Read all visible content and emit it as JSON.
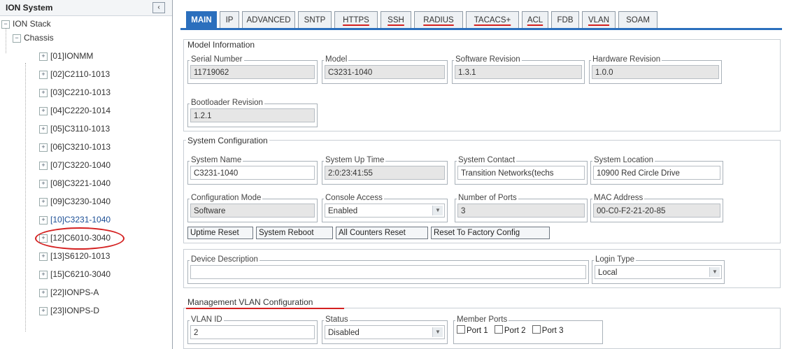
{
  "tree": {
    "title": "ION System",
    "collapse_icon": "‹",
    "stack_label": "ION Stack",
    "chassis_label": "Chassis",
    "items": [
      "[01]IONMM",
      "[02]C2110-1013",
      "[03]C2210-1013",
      "[04]C2220-1014",
      "[05]C3110-1013",
      "[06]C3210-1013",
      "[07]C3220-1040",
      "[08]C3221-1040",
      "[09]C3230-1040",
      "[10]C3231-1040",
      "[12]C6010-3040",
      "[13]S6120-1013",
      "[15]C6210-3040",
      "[22]IONPS-A",
      "[23]IONPS-D"
    ],
    "selected_item": "[10]C3231-1040"
  },
  "tabs": [
    {
      "label": "MAIN",
      "active": true
    },
    {
      "label": "IP"
    },
    {
      "label": "ADVANCED"
    },
    {
      "label": "SNTP"
    },
    {
      "label": "HTTPS"
    },
    {
      "label": "SSH"
    },
    {
      "label": "RADIUS"
    },
    {
      "label": "TACACS+"
    },
    {
      "label": "ACL"
    },
    {
      "label": "FDB"
    },
    {
      "label": "VLAN"
    },
    {
      "label": "SOAM"
    }
  ],
  "model_info": {
    "title": "Model Information",
    "serial_label": "Serial Number",
    "serial_value": "11719062",
    "model_label": "Model",
    "model_value": "C3231-1040",
    "sw_label": "Software Revision",
    "sw_value": "1.3.1",
    "hw_label": "Hardware Revision",
    "hw_value": "1.0.0",
    "boot_label": "Bootloader Revision",
    "boot_value": "1.2.1"
  },
  "system_config": {
    "title": "System Configuration",
    "name_label": "System Name",
    "name_value": "C3231-1040",
    "uptime_label": "System Up Time",
    "uptime_value": "2:0:23:41:55",
    "contact_label": "System Contact",
    "contact_value": "Transition Networks(techs",
    "location_label": "System Location",
    "location_value": "10900 Red Circle Drive",
    "config_mode_label": "Configuration Mode",
    "config_mode_value": "Software",
    "console_label": "Console Access",
    "console_value": "Enabled",
    "ports_label": "Number of Ports",
    "ports_value": "3",
    "mac_label": "MAC Address",
    "mac_value": "00-C0-F2-21-20-85",
    "buttons": {
      "uptime_reset": "Uptime Reset",
      "system_reboot": "System Reboot",
      "all_counters_reset": "All Counters Reset",
      "factory_reset": "Reset To Factory Config"
    }
  },
  "device": {
    "desc_label": "Device Description",
    "desc_value": "",
    "login_label": "Login Type",
    "login_value": "Local"
  },
  "mgmt_vlan": {
    "title": "Management VLAN Configuration",
    "vlan_id_label": "VLAN ID",
    "vlan_id_value": "2",
    "status_label": "Status",
    "status_value": "Disabled",
    "member_label": "Member Ports",
    "ports": [
      "Port 1",
      "Port 2",
      "Port 3"
    ]
  },
  "colors": {
    "active_tab": "#2b6fbd",
    "annotation_red": "#d42020"
  }
}
